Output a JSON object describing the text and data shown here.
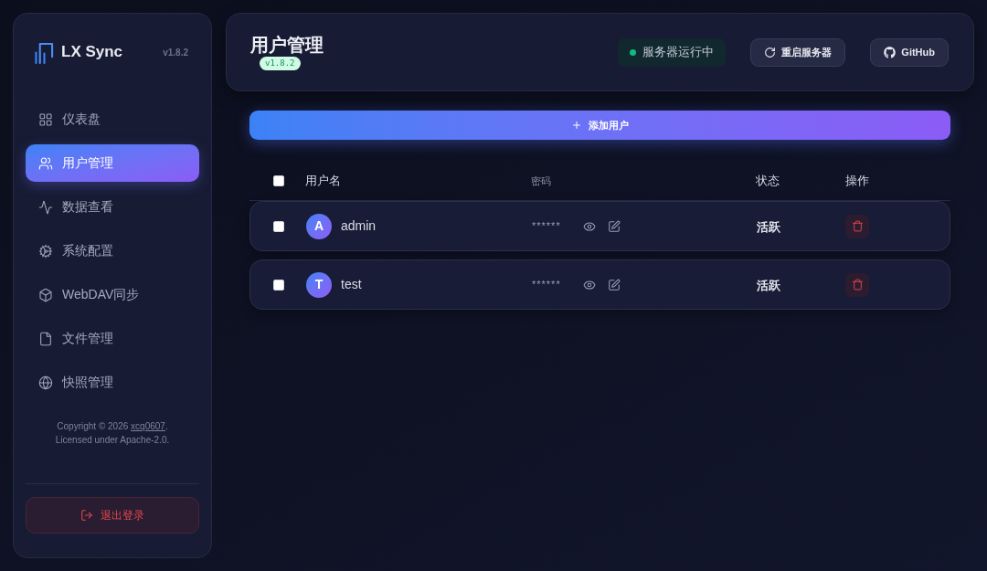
{
  "sidebar": {
    "brand": "LX Sync",
    "version": "v1.8.2",
    "nav": [
      {
        "label": "仪表盘",
        "selected": false
      },
      {
        "label": "用户管理",
        "selected": true
      },
      {
        "label": "数据查看",
        "selected": false
      },
      {
        "label": "系统配置",
        "selected": false
      },
      {
        "label": "WebDAV同步",
        "selected": false
      },
      {
        "label": "文件管理",
        "selected": false
      },
      {
        "label": "快照管理",
        "selected": false
      }
    ],
    "copyright": {
      "text": "Copyright © 2026",
      "link": "xcq0607",
      "end": "."
    },
    "license": "Licensed under Apache-2.0.",
    "logout": {
      "label": "退出登录"
    }
  },
  "header": {
    "title": "用户管理",
    "version": "v1.8.2",
    "server_status": {
      "label": "服务器运行中",
      "running": true
    },
    "buttons": [
      {
        "label": "重启服务器"
      },
      {
        "label": "GitHub"
      }
    ]
  },
  "toolbar": {
    "add_button": {
      "label": "添加用户"
    }
  },
  "table": {
    "select_all": {
      "checked": false
    },
    "columns": [
      {
        "label": "用户名"
      },
      {
        "label": "密码"
      },
      {
        "label": "状态"
      },
      {
        "label": "操作"
      }
    ],
    "rows": [
      {
        "checked": false,
        "avatar": "A",
        "username": "admin",
        "password": "******",
        "status": "活跃"
      },
      {
        "checked": false,
        "avatar": "T",
        "username": "test",
        "password": "******",
        "status": "活跃"
      }
    ]
  }
}
